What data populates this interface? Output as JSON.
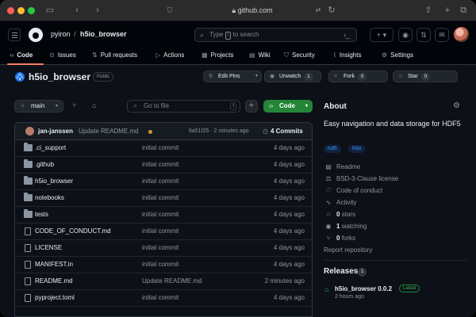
{
  "browser": {
    "address": "github.com",
    "icons": [
      "sidebar-icon",
      "back-icon",
      "forward-icon",
      "shield-icon",
      "lock-icon",
      "translate-icon",
      "reload-icon",
      "share-icon",
      "new-tab-icon",
      "tabs-overview-icon"
    ]
  },
  "header": {
    "owner": "pyiron",
    "separator": "/",
    "repo": "h5io_browser",
    "search_placeholder_prefix": "Type",
    "search_key": "/",
    "search_placeholder_suffix": "to search",
    "buttons": [
      "terminal-icon",
      "plus-icon",
      "issues-icon",
      "pull-requests-icon",
      "inbox-icon"
    ]
  },
  "nav": {
    "tabs": [
      {
        "label": "Code",
        "icon": "code-icon"
      },
      {
        "label": "Issues",
        "icon": "issue-icon"
      },
      {
        "label": "Pull requests",
        "icon": "pull-request-icon"
      },
      {
        "label": "Actions",
        "icon": "play-icon"
      },
      {
        "label": "Projects",
        "icon": "table-icon"
      },
      {
        "label": "Wiki",
        "icon": "book-icon"
      },
      {
        "label": "Security",
        "icon": "shield-icon"
      },
      {
        "label": "Insights",
        "icon": "graph-icon"
      },
      {
        "label": "Settings",
        "icon": "gear-icon"
      }
    ]
  },
  "repo": {
    "name": "h5io_browser",
    "visibility": "Public",
    "edit_pins": "Edit Pins",
    "unwatch": "Unwatch",
    "watch_count": "1",
    "fork": "Fork",
    "fork_count": "0",
    "star": "Star",
    "star_count": "0"
  },
  "toolbar": {
    "branch": "main",
    "goto_placeholder": "Go to file",
    "goto_key": "t",
    "code_label": "Code"
  },
  "commit": {
    "author": "jan-janssen",
    "message": "Update README.md",
    "hash_time": "6a51f25 · 2 minutes ago",
    "count": "4 Commits"
  },
  "files": [
    {
      "type": "folder",
      "name": ".ci_support",
      "message": "initial commit",
      "date": "4 days ago"
    },
    {
      "type": "folder",
      "name": ".github",
      "message": "initial commit",
      "date": "4 days ago"
    },
    {
      "type": "folder",
      "name": "h5io_browser",
      "message": "initial commit",
      "date": "4 days ago"
    },
    {
      "type": "folder",
      "name": "notebooks",
      "message": "initial commit",
      "date": "4 days ago"
    },
    {
      "type": "folder",
      "name": "tests",
      "message": "initial commit",
      "date": "4 days ago"
    },
    {
      "type": "file",
      "name": "CODE_OF_CONDUCT.md",
      "message": "initial commit",
      "date": "4 days ago"
    },
    {
      "type": "file",
      "name": "LICENSE",
      "message": "initial commit",
      "date": "4 days ago"
    },
    {
      "type": "file",
      "name": "MANIFEST.in",
      "message": "initial commit",
      "date": "4 days ago"
    },
    {
      "type": "file",
      "name": "README.md",
      "message": "Update README.md",
      "date": "2 minutes ago"
    },
    {
      "type": "file",
      "name": "pyproject.toml",
      "message": "initial commit",
      "date": "4 days ago"
    }
  ],
  "about": {
    "heading": "About",
    "description": "Easy navigation and data storage for HDF5",
    "topics": [
      "hdf5",
      "h5io"
    ],
    "readme": "Readme",
    "license": "BSD-3-Clause license",
    "conduct": "Code of conduct",
    "activity": "Activity",
    "stars_num": "0",
    "stars_label": "stars",
    "watching_num": "1",
    "watching_label": "watching",
    "forks_num": "0",
    "forks_label": "forks",
    "report": "Report repository"
  },
  "releases": {
    "heading": "Releases",
    "count": "1",
    "name": "h5io_browser 0.0.2",
    "badge": "Latest",
    "time": "2 hours ago"
  },
  "colors": {
    "accent_green": "#238636",
    "link_blue": "#4493f8",
    "tab_underline": "#f78166",
    "background": "#0d1117"
  }
}
